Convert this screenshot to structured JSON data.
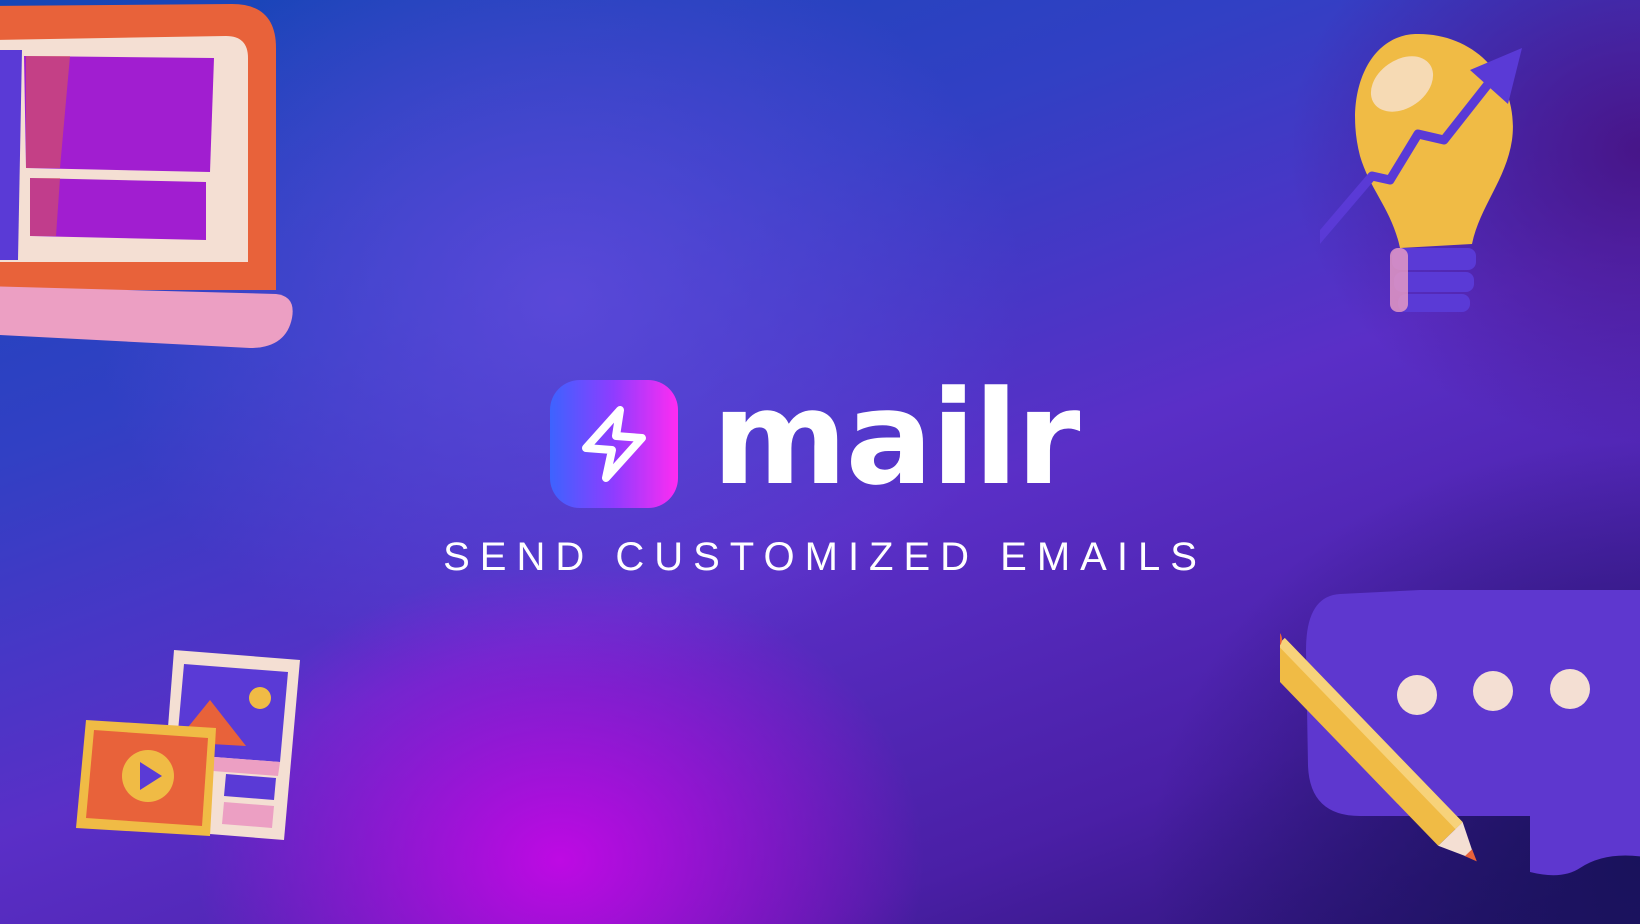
{
  "brand": {
    "name": "mailr",
    "tagline": "SEND CUSTOMIZED EMAILS",
    "logo_icon": "lightning-bolt-icon"
  },
  "decorations": {
    "top_left": "laptop-illustration",
    "top_right": "lightbulb-growth-illustration",
    "bottom_left": "photo-video-illustration",
    "bottom_right": "chat-bubble-pencil-illustration"
  },
  "colors": {
    "gradient_blue": "#1546b6",
    "gradient_violet": "#5a2fc7",
    "gradient_magenta": "#c408e6",
    "gradient_navy": "#26126d",
    "icon_start": "#3d63ff",
    "icon_end": "#ff2cf2",
    "text": "#ffffff"
  }
}
